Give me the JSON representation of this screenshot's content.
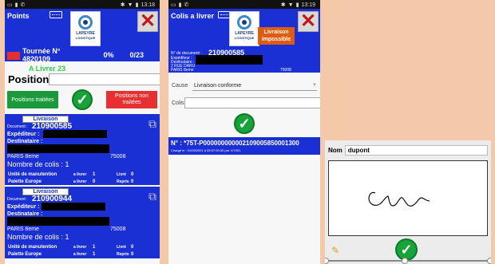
{
  "screen1": {
    "status": {
      "time": "13:18"
    },
    "title": "Points",
    "logo": {
      "brand": "LAPEYRE",
      "sub": "LOGISTIQUE"
    },
    "tour": {
      "label": "Tournée N° 4820109",
      "percent": "0%",
      "count": "0/23"
    },
    "a_livrer": "A Livrer 23",
    "position_label": "Position",
    "btn_traitees": "Positions traitées",
    "btn_non_traitees": "Positions non traitées",
    "cards": [
      {
        "tag": "Livraison",
        "doc_label": "Document :",
        "doc": "210900585",
        "exp": "Expéditeur :",
        "dest": "Destinataire :",
        "city": "PARIS 8eme",
        "cp": "75008",
        "nb": "Nombre de colis :  1",
        "row1": {
          "label": "Unité de manutention",
          "a": "a livrer",
          "av": "1",
          "b": "Livré",
          "bv": "0"
        },
        "row2": {
          "label": "Palette Europe",
          "a": "a livrer",
          "av": "0",
          "b": "Repris",
          "bv": "0"
        }
      },
      {
        "tag": "Livraison",
        "doc_label": "Document :",
        "doc": "210900944",
        "exp": "Expéditeur :",
        "dest": "Destinataire :",
        "city": "PARIS 8eme",
        "cp": "75008",
        "nb": "Nombre de colis :  1",
        "row1": {
          "label": "Unité de manutention",
          "a": "a livrer",
          "av": "1",
          "b": "Livré",
          "bv": "0"
        },
        "row2": {
          "label": "Palette Europe",
          "a": "a livrer",
          "av": "1",
          "b": "Repris",
          "bv": "0"
        }
      }
    ]
  },
  "screen2": {
    "status": {
      "time": "13:19"
    },
    "title": "Colis a livrer",
    "logo": {
      "brand": "LAPEYRE",
      "sub": "LOGISTIQUE"
    },
    "liv_impossible": "Livraison impossible",
    "doc_label": "N° de document :",
    "doc": "210900585",
    "exp": "Expéditeur :",
    "dest": "Destinataire :",
    "addr": "2 RUE DARU",
    "city": "PARIS 8eme",
    "cp": "75008",
    "cause_label": "Cause",
    "cause_value": "Livraison conforme",
    "colis_label": "Colis",
    "ref": "N° :  *75T-P000000000002109005850001300",
    "charge": "Chargé le : 01/09/2021 à 05:07:00:00 par :KY001"
  },
  "screen3": {
    "nom_label": "Nom",
    "nom_value": "dupont"
  }
}
